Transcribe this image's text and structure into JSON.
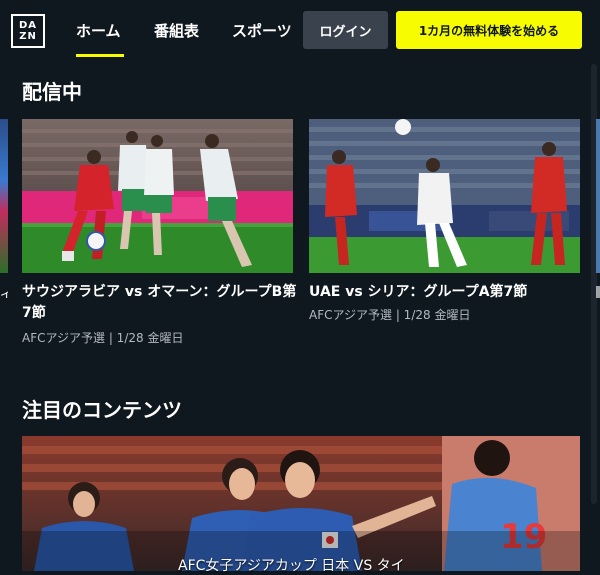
{
  "header": {
    "logo_lines": [
      "DA",
      "ZN"
    ],
    "nav": [
      "ホーム",
      "番組表",
      "スポーツ"
    ],
    "login_label": "ログイン",
    "trial_label": "1カ月の無料体験を始める"
  },
  "live": {
    "title": "配信中",
    "cards": [
      {
        "title": "サウジアラビア vs オマーン：グループB第7節",
        "subtitle": "AFCアジア予選 | 1/28 金曜日"
      },
      {
        "title": "UAE vs シリア：グループA第7節",
        "subtitle": "AFCアジア予選 | 1/28 金曜日"
      }
    ]
  },
  "featured": {
    "title": "注目のコンテンツ",
    "caption": "AFC女子アジアカップ 日本 VS タイ"
  },
  "colors": {
    "background": "#0f171f",
    "accent_yellow": "#f8fc00",
    "login_bg": "#3a434d",
    "subtitle_gray": "#b3b9c0"
  },
  "icons": [
    "dazn-logo"
  ]
}
